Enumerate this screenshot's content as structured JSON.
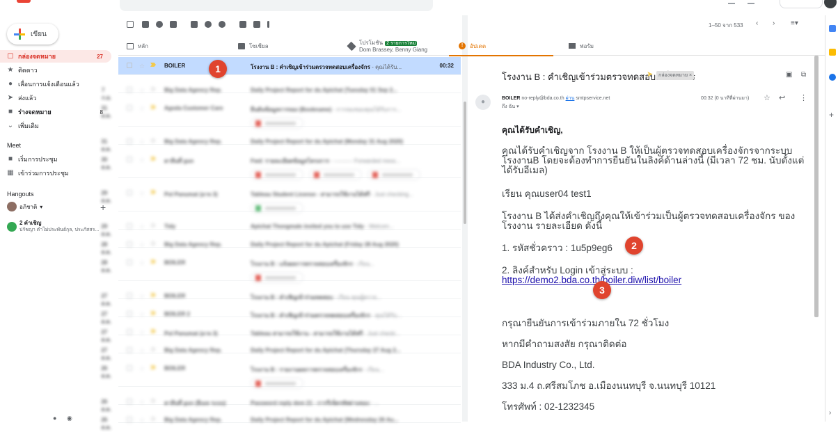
{
  "nav": {
    "compose": "เขียน",
    "items": [
      {
        "label": "กล่องจดหมาย",
        "count": "27",
        "icon": "inbox-icon"
      },
      {
        "label": "ติดดาว",
        "count": "",
        "icon": "star-icon"
      },
      {
        "label": "เลื่อนการแจ้งเตือนแล้ว",
        "count": "",
        "icon": "clock-icon"
      },
      {
        "label": "ส่งแล้ว",
        "count": "",
        "icon": "send-icon"
      },
      {
        "label": "ร่างจดหมาย",
        "count": "8",
        "icon": "draft-icon"
      },
      {
        "label": "เพิ่มเติม",
        "count": "",
        "icon": "chevron-down-icon"
      }
    ],
    "meet": "Meet",
    "meet_items": [
      "เริ่มการประชุม",
      "เข้าร่วมการประชุม"
    ],
    "hangouts": "Hangouts",
    "hangout_user": "อภิชาติ",
    "hangout_invite_title": "2 คำเชิญ",
    "hangout_invite_sub": "ปรัชญา ตำไม่ประพันธ์กุล, ประภัสสร..."
  },
  "toolbar": {
    "pagination": "1–50 จาก 533"
  },
  "tabs": {
    "primary": "หลัก",
    "social": "โซเชียล",
    "promotions": "โปรโมชัน",
    "promotions_badge": "2 รายการใหม่",
    "promotions_sub": "Dom Brassey, Benny Giang",
    "updates": "อัปเดต",
    "forums": "ฟอรัม"
  },
  "rows": [
    {
      "sender": "BOILER",
      "subject": "โรงงาน B : คำเชิญเข้าร่วมตรวจทดสอบเครื่องจักร",
      "snippet": " - คุณได้รับ...",
      "time": "00:32"
    },
    {
      "sender": "Big Data Agency Rep.",
      "subject": "Daily Project Report for du Apichat (Tuesday 01 Sep 2...",
      "snippet": "",
      "time": "7 ก.ย."
    },
    {
      "sender": "Agoda Customer Care",
      "subject": "ยืนยันข้อมูลการจอง (Bookname)",
      "snippet": " - การจองของคุณได้รับการ...",
      "time": "31 ส.ค."
    },
    {
      "sender": "Big Data Agency Rep.",
      "subject": "Daily Project Report for du Apichat (Monday 31 Aug 2020)",
      "snippet": "",
      "time": "31 ส.ค."
    },
    {
      "sender": "ตาลีนที่ gun",
      "subject": "Fwd: รายละเอียดข้อมูลโครงการ",
      "snippet": " - ---------- Forwarded mess...",
      "time": "30 ส.ค."
    },
    {
      "sender": "Pol Panumat (อาจ 3)",
      "subject": "Tableau Student License - สามารถใช้งานได้ฟรี",
      "snippet": " - Just checking...",
      "time": "29 ส.ค."
    },
    {
      "sender": "Tidy",
      "subject": "Apichat Thongmale invited you to use Tidy",
      "snippet": " - Welcom...",
      "time": "29 ส.ค."
    },
    {
      "sender": "Big Data Agency Rep.",
      "subject": "Daily Project Report for du Apichat (Friday 28 Aug 2020)",
      "snippet": "",
      "time": "28 ส.ค."
    },
    {
      "sender": "BOILER",
      "subject": "โรงงาน B : แจ้งผลการตรวจสอบเครื่องจักร",
      "snippet": " - เรียน...",
      "time": "28 ส.ค."
    },
    {
      "sender": "BOILER",
      "subject": "โรงงาน B : คำเชิญเข้าร่วมทดสอบ",
      "snippet": " - เรียน คุณผู้ตรวจ...",
      "time": "27 ส.ค."
    },
    {
      "sender": "BOILER 2",
      "subject": "โรงงาน B : คำเชิญเข้าร่วมตรวจทดสอบเครื่องจักร",
      "snippet": " - คุณได้รับ...",
      "time": "27 ส.ค."
    },
    {
      "sender": "Pol Panumat (อาจ 3)",
      "subject": "Tableau สามารถใช้งาน - สามารถใช้งานได้ฟรี",
      "snippet": " - Just checki...",
      "time": "27 ส.ค."
    },
    {
      "sender": "Big Data Agency Rep.",
      "subject": "Daily Project Report for du Apichat (Thursday 27 Aug 2...",
      "snippet": "",
      "time": "27 ส.ค."
    },
    {
      "sender": "BOILER",
      "subject": "โรงงาน B : รายงานผลการตรวจสอบเครื่องจักร",
      "snippet": " - เรียน...",
      "time": "26 ส.ค."
    },
    {
      "sender": "ตาลีนที่ gun (อีเมล ระบบ)",
      "subject": "Password reply dem 21 - การรีเซ็ตรหัสผ่านของ",
      "snippet": " - ...",
      "time": "26 ส.ค."
    },
    {
      "sender": "Big Data Agency Rep.",
      "subject": "Daily Project Report for du Apichat (Wednesday 26 Au...",
      "snippet": "",
      "time": "26 ส.ค."
    }
  ],
  "email": {
    "subject": "โรงงาน B : คำเชิญเข้าร่วมตรวจทดสอบเครื่องจักร",
    "label": "กล่องจดหมาย ×",
    "sender": "BOILER",
    "sender_email": "no-reply@bda.co.th",
    "via_label": "ผ่าน",
    "via": "smtpservice.net",
    "to": "ถึง ฉัน ▾",
    "time": "00:32 (0 นาทีที่ผ่านมา)",
    "greeting": "คุณได้รับคำเชิญ,",
    "para1": "คุณได้รับคำเชิญจาก โรงงาน B ให้เป็นผู้ตรวจทดสอบเครื่องจักรจากระบบ โรงงานB โดยจะต้องทำการยืนยันในลิงค์ด้านล่างนี้ (มีเวลา 72 ชม. นับตั้งแต่ได้รับอีเมล)",
    "dear": "เรียน คุณuser04 test1",
    "para2": "โรงงาน B ได้ส่งคำเชิญถึงคุณให้เข้าร่วมเป็นผู้ตรวจทดสอบเครื่องจักร ของโรงงาน รายละเอียด ดังนี้",
    "temp_code": "1. รหัสชั่วคราว : 1u5p9eg6",
    "login_prefix": "2. ลิงค์สำหรับ Login เข้าสู่ระบบ : ",
    "login_link": "https://demo2.bda.co.th/boiler.diw/list/boiler",
    "confirm": "กรุณายืนยันการเข้าร่วมภายใน 72 ชั่วโมง",
    "contact": "หากมีคำถามสงสัย กรุณาติดต่อ",
    "company": "BDA Industry Co., Ltd.",
    "address": "333 ม.4 ถ.ศรีสมโภช อ.เมืองนนทบุรี จ.นนทบุรี 10121",
    "phone": "โทรศัพท์ : 02-1232345"
  },
  "markers": [
    "1",
    "2",
    "3"
  ],
  "colors": {
    "accent_red": "#d93025",
    "marker": "#e0442e",
    "updates": "#e37400",
    "selected_row": "#c2dbff"
  }
}
